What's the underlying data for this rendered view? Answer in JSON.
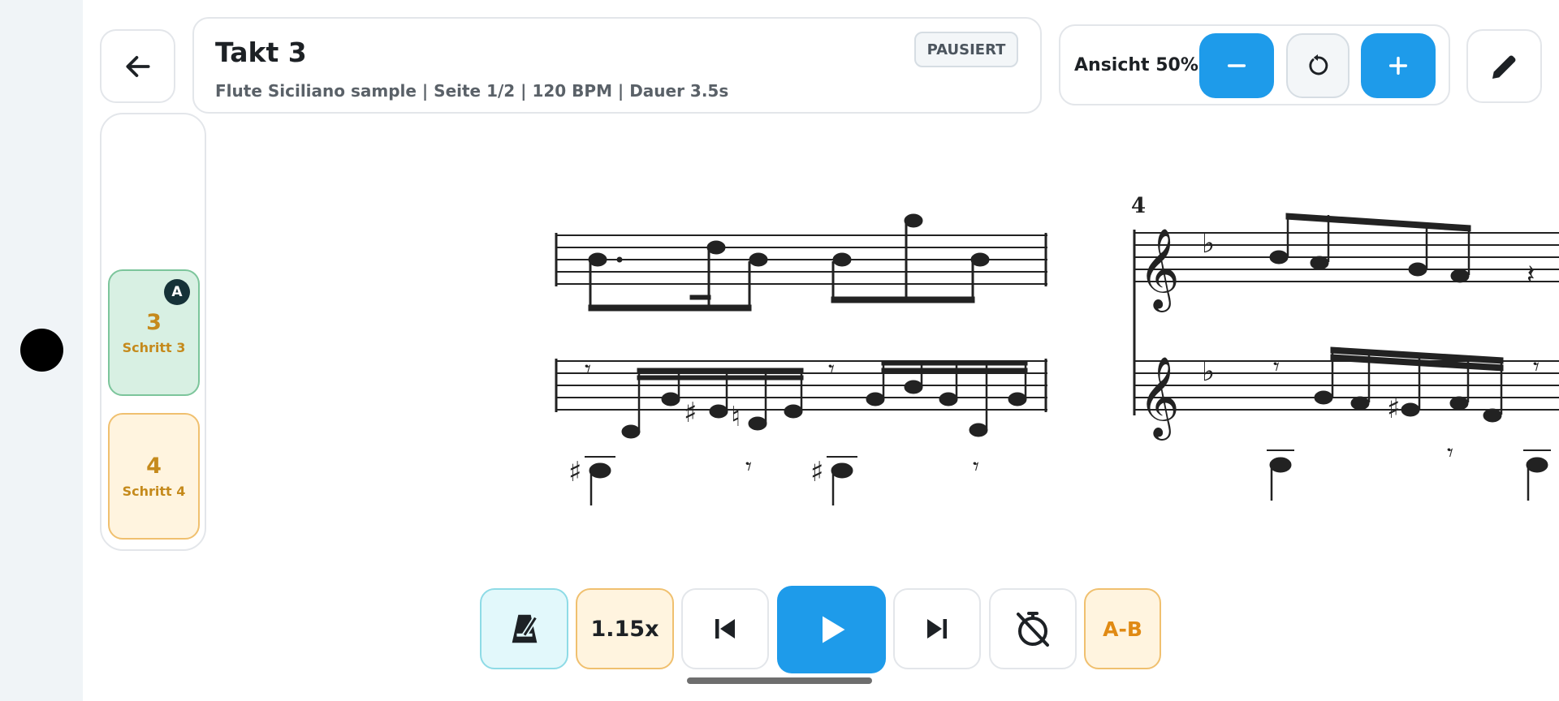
{
  "header": {
    "title": "Takt 3",
    "subtitle": "Flute Siciliano sample | Seite 1/2 | 120 BPM | Dauer 3.5s",
    "status_badge": "PAUSIERT"
  },
  "zoom": {
    "label": "Ansicht 50%"
  },
  "steps": [
    {
      "number": "3",
      "label": "Schritt 3",
      "marker": "A"
    },
    {
      "number": "4",
      "label": "Schritt 4"
    }
  ],
  "score": {
    "measure_number": "4"
  },
  "transport": {
    "speed": "1.15x",
    "ab_loop": "A-B"
  },
  "colors": {
    "accent_blue": "#1e9bea",
    "step_active_bg": "#d8f0e3",
    "step_next_bg": "#fff4df",
    "step_text": "#c58a1c"
  }
}
